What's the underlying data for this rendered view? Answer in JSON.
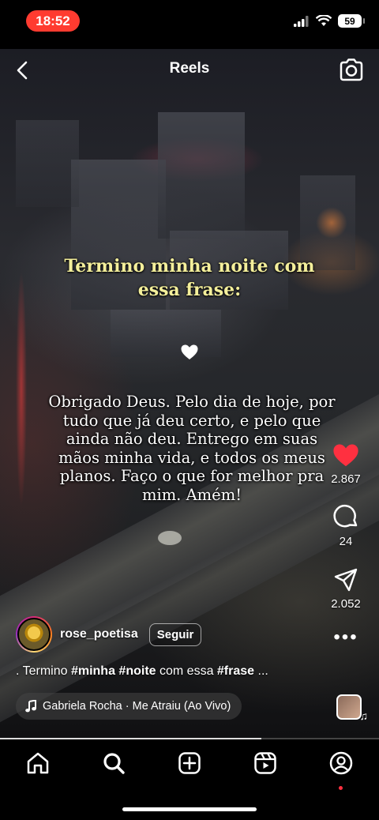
{
  "status_bar": {
    "time": "18:52",
    "battery": "59"
  },
  "header": {
    "title": "Reels"
  },
  "reel": {
    "overlay_heading": "Termino minha noite com essa frase:",
    "overlay_quote": "Obrigado Deus. Pelo dia de hoje, por tudo que já deu certo, e pelo que ainda não deu. Entrego em suas mãos minha vida, e todos os meus planos. Faço o que for melhor pra mim. Amém!",
    "likes": "2.867",
    "comments": "24",
    "shares": "2.052",
    "progress": 0.69
  },
  "author": {
    "username": "rose_poetisa",
    "follow_label": "Seguir"
  },
  "caption": {
    "prefix": ". Termino ",
    "tag1": "#minha",
    "tag2": "#noite",
    "middle": " com essa ",
    "tag3": "#frase",
    "suffix": " ..."
  },
  "audio": {
    "label": "Gabriela Rocha · Me Atraiu (Ao Vivo)"
  },
  "colors": {
    "like": "#ff3040",
    "time_pill": "#ff3b30",
    "heading_yellow": "#f4ef9b"
  },
  "icons": {
    "nav": [
      "home-icon",
      "search-icon",
      "create-icon",
      "reels-icon",
      "profile-icon"
    ]
  }
}
